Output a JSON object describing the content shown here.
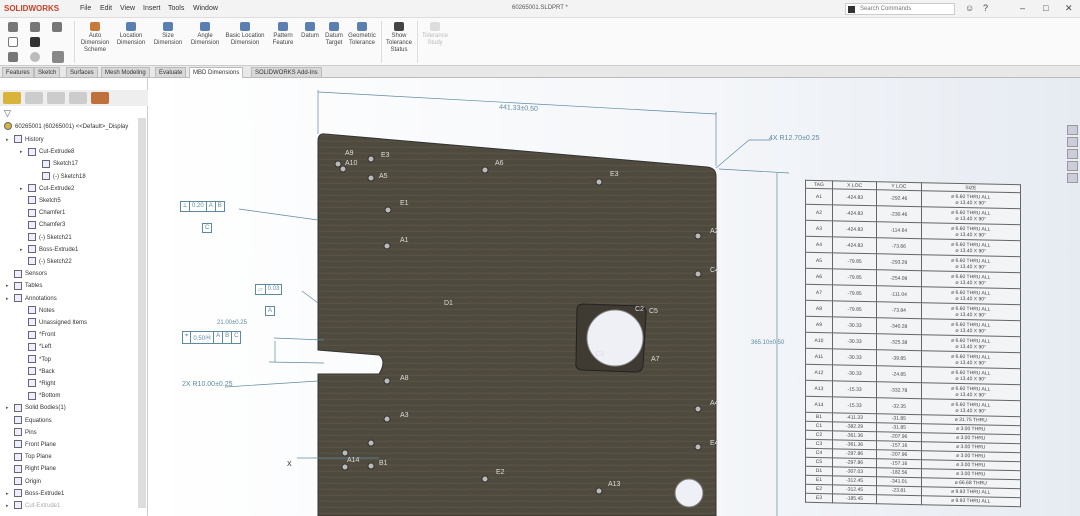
{
  "app": {
    "logo": "SOLIDWORKS",
    "menus": [
      "File",
      "Edit",
      "View",
      "Insert",
      "Tools",
      "Window"
    ],
    "doc_title": "60265001.SLDPRT *",
    "search_placeholder": "Search Commands",
    "win": [
      "–",
      "□",
      "✕"
    ]
  },
  "ribbon": {
    "buttons": [
      "Auto Dimension Scheme",
      "Location Dimension",
      "Size Dimension",
      "Angle Dimension",
      "Basic Location Dimension",
      "Pattern Feature",
      "Datum",
      "Datum Target",
      "Geometric Tolerance",
      "Show Tolerance Status",
      "Tolerance Study"
    ]
  },
  "tabs": [
    "Features",
    "Sketch",
    "Surfaces",
    "Mesh Modeling",
    "Evaluate",
    "MBD Dimensions",
    "SOLIDWORKS Add-Ins"
  ],
  "active_tab": "MBD Dimensions",
  "tree": {
    "root": "60265001 (60265001) <<Default>_Display",
    "items": [
      {
        "label": "History",
        "lvl": 0,
        "exp": true
      },
      {
        "label": "Cut-Extrude8",
        "lvl": 1,
        "exp": true
      },
      {
        "label": "Sketch17",
        "lvl": 2
      },
      {
        "label": "(-) Sketch18",
        "lvl": 2
      },
      {
        "label": "Cut-Extrude2",
        "lvl": 1,
        "exp": true
      },
      {
        "label": "Sketch5",
        "lvl": 1
      },
      {
        "label": "Chamfer1",
        "lvl": 1
      },
      {
        "label": "Chamfer3",
        "lvl": 1
      },
      {
        "label": "(-) Sketch21",
        "lvl": 1
      },
      {
        "label": "Boss-Extrude1",
        "lvl": 1,
        "exp": true
      },
      {
        "label": "(-) Sketch22",
        "lvl": 1
      },
      {
        "label": "Sensors",
        "lvl": 0
      },
      {
        "label": "Tables",
        "lvl": 0,
        "exp": true
      },
      {
        "label": "Annotations",
        "lvl": 0,
        "exp": true
      },
      {
        "label": "Notes",
        "lvl": 1
      },
      {
        "label": "Unassigned Items",
        "lvl": 1
      },
      {
        "label": "*Front",
        "lvl": 1
      },
      {
        "label": "*Left",
        "lvl": 1
      },
      {
        "label": "*Top",
        "lvl": 1
      },
      {
        "label": "*Back",
        "lvl": 1
      },
      {
        "label": "*Right",
        "lvl": 1
      },
      {
        "label": "*Bottom",
        "lvl": 1
      },
      {
        "label": "Solid Bodies(1)",
        "lvl": 0,
        "exp": true
      },
      {
        "label": "Equations",
        "lvl": 0
      },
      {
        "label": "Pins",
        "lvl": 0
      },
      {
        "label": "Front Plane",
        "lvl": 0
      },
      {
        "label": "Top Plane",
        "lvl": 0
      },
      {
        "label": "Right Plane",
        "lvl": 0
      },
      {
        "label": "Origin",
        "lvl": 0
      },
      {
        "label": "Boss-Extrude1",
        "lvl": 0,
        "exp": true
      },
      {
        "label": "Cut-Extrude1",
        "lvl": 0,
        "exp": true,
        "dis": true
      }
    ]
  },
  "annotations": {
    "width_dim": "441.33±0.50",
    "height_dim": "365.10±0.50",
    "corner_radius": "4X R12.70±0.25",
    "slot_radius": "2X R10.00±0.25",
    "slot_dim": "21.00±0.25",
    "fcf1": [
      "⟂",
      "0.20",
      "A",
      "B"
    ],
    "fcf1_datum": "C",
    "fcf2": [
      "⏥",
      "0.03"
    ],
    "fcf2_datum": "A",
    "fcf3": [
      "⌖",
      "0.50Ⓜ",
      "A",
      "B",
      "C"
    ],
    "axis_x": "X"
  },
  "hole_labels": [
    "A9",
    "A10",
    "E3",
    "A5",
    "A6",
    "E3",
    "E1",
    "A1",
    "A2",
    "C4",
    "D1",
    "C2",
    "C5",
    "C3",
    "A7",
    "A8",
    "A3",
    "A4",
    "E4",
    "E2",
    "A13",
    "A14",
    "B1"
  ],
  "table": {
    "headers": [
      "TAG",
      "X LOC",
      "Y LOC",
      "SIZE"
    ],
    "big_rows": [
      [
        "A1",
        "-424.83",
        "-292.46"
      ],
      [
        "A2",
        "-424.83",
        "-230.46"
      ],
      [
        "A3",
        "-424.83",
        "-114.64"
      ],
      [
        "A4",
        "-424.83",
        "-73.66"
      ],
      [
        "A5",
        "-79.85",
        "-293.29"
      ],
      [
        "A6",
        "-79.85",
        "-254.09"
      ],
      [
        "A7",
        "-79.85",
        "-111.04"
      ],
      [
        "A8",
        "-79.85",
        "-73.84"
      ],
      [
        "A9",
        "-30.33",
        "-340.28"
      ],
      [
        "A10",
        "-30.33",
        "-325.38"
      ],
      [
        "A11",
        "-30.33",
        "-39.85"
      ],
      [
        "A12",
        "-30.33",
        "-24.85"
      ],
      [
        "A13",
        "-15.33",
        "-332.78"
      ],
      [
        "A14",
        "-15.33",
        "-32.35"
      ]
    ],
    "big_size_1": "⌀ 6.60 THRU ALL",
    "big_size_2": "⌀ 13.40 X 90°",
    "small_rows": [
      [
        "B1",
        "-411.33",
        "-31.85",
        "⌀ 31.75 THRU"
      ],
      [
        "C1",
        "-382.29",
        "-31.85",
        "⌀ 3.00 THRU"
      ],
      [
        "C2",
        "-361.36",
        "-207.96",
        "⌀ 3.00 THRU"
      ],
      [
        "C3",
        "-361.36",
        "-157.16",
        "⌀ 3.00 THRU"
      ],
      [
        "C4",
        "-297.86",
        "-207.96",
        "⌀ 3.00 THRU"
      ],
      [
        "C5",
        "-297.86",
        "-157.16",
        "⌀ 3.00 THRU"
      ],
      [
        "D1",
        "-307.03",
        "-182.56",
        "⌀ 3.00 THRU"
      ],
      [
        "E1",
        "-312.45",
        "-341.01",
        "⌀ 66.68 THRU"
      ],
      [
        "E2",
        "-312.45",
        "-23.81",
        "⌀ 9.93 THRU ALL"
      ],
      [
        "E3",
        "-185.45",
        "",
        "⌀ 9.93 THRU ALL"
      ]
    ]
  }
}
